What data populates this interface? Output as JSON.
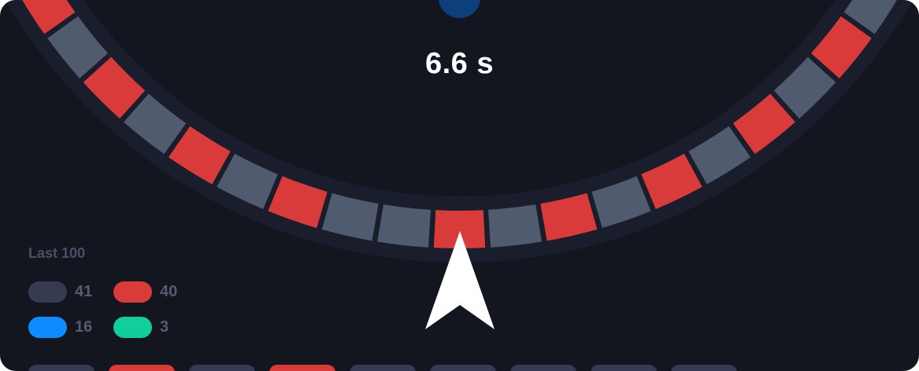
{
  "colors": {
    "background": "#13151f",
    "ring": "#1a1d2b",
    "gray": "#515b6f",
    "red": "#d93b3b",
    "blue": "#0d8bff",
    "green": "#10cf9a",
    "ball": "#0d3f7c",
    "pointer": "#ffffff"
  },
  "timer": {
    "text": "6.6 s"
  },
  "wheel": {
    "segments": [
      "gray",
      "blue",
      "gray",
      "blue",
      "gray",
      "red",
      "gray",
      "red",
      "gray",
      "red",
      "gray",
      "red",
      "gray",
      "red",
      "gray",
      "red",
      "gray",
      "gray",
      "red",
      "gray",
      "red",
      "gray",
      "red",
      "gray",
      "red",
      "gray",
      "red",
      "gray",
      "red",
      "gray",
      "red",
      "gray",
      "gray",
      "blue",
      "gray",
      "blue",
      "gray"
    ]
  },
  "last100": {
    "title": "Last 100",
    "items": [
      {
        "color": "gray",
        "count": "41"
      },
      {
        "color": "red",
        "count": "40"
      },
      {
        "color": "blue",
        "count": "16"
      },
      {
        "color": "green",
        "count": "3"
      }
    ]
  },
  "history": [
    "gray",
    "red",
    "gray",
    "red",
    "gray",
    "gray",
    "gray",
    "gray",
    "gray"
  ]
}
